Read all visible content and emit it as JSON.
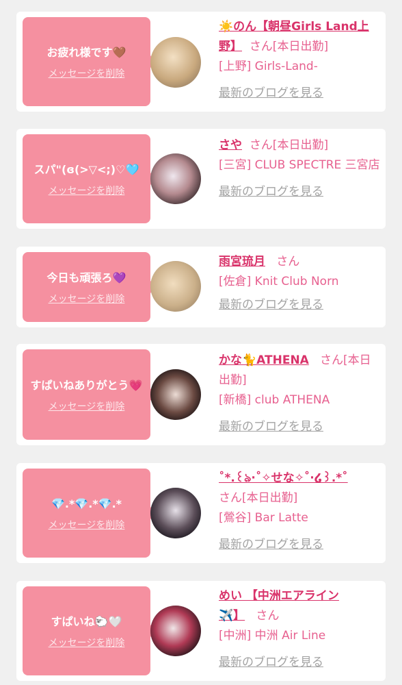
{
  "colors": {
    "bubble": "#f590a0",
    "accent": "#d9336a",
    "text_pink": "#e7608f",
    "muted": "#a3a3a3"
  },
  "cards": [
    {
      "message": "お疲れ様です🤎",
      "delete_label": "メッセージを削除",
      "name": "☀️のん【朝昼Girls Land上野】",
      "san": "さん[本日出勤]",
      "shop": "[上野] Girls-Land-",
      "blog": "最新のブログを見る"
    },
    {
      "message": "スパ\"(ɞ(>▽<;)♡🩵",
      "delete_label": "メッセージを削除",
      "name": "さや",
      "san": "さん[本日出勤]",
      "shop": "[三宮] CLUB SPECTRE 三宮店",
      "blog": "最新のブログを見る"
    },
    {
      "message": "今日も頑張ろ💜",
      "delete_label": "メッセージを削除",
      "name": "雨宮琉月",
      "san": "さん",
      "shop": "[佐倉] Knit Club Norn",
      "blog": "最新のブログを見る"
    },
    {
      "message": "すぱいねありがとう💗",
      "delete_label": "メッセージを削除",
      "name": "かな🐈ATHENA",
      "san": "さん[本日出勤]",
      "shop": "[新橋] club ATHENA",
      "blog": "最新のブログを見る"
    },
    {
      "message": "💎.*💎.*💎.*",
      "delete_label": "メッセージを削除",
      "name": "˚*.꒰ঌ·˚✧せな✧˚·໒꒱.*˚",
      "san": "さん[本日出勤]",
      "shop": "[鶯谷] Bar Latte",
      "blog": "最新のブログを見る"
    },
    {
      "message": "すぱいね🐑🤍",
      "delete_label": "メッセージを削除",
      "name": "めい 【中洲エアライン✈️】",
      "san": "さん",
      "shop": "[中洲] 中洲 Air Line",
      "blog": "最新のブログを見る"
    }
  ]
}
